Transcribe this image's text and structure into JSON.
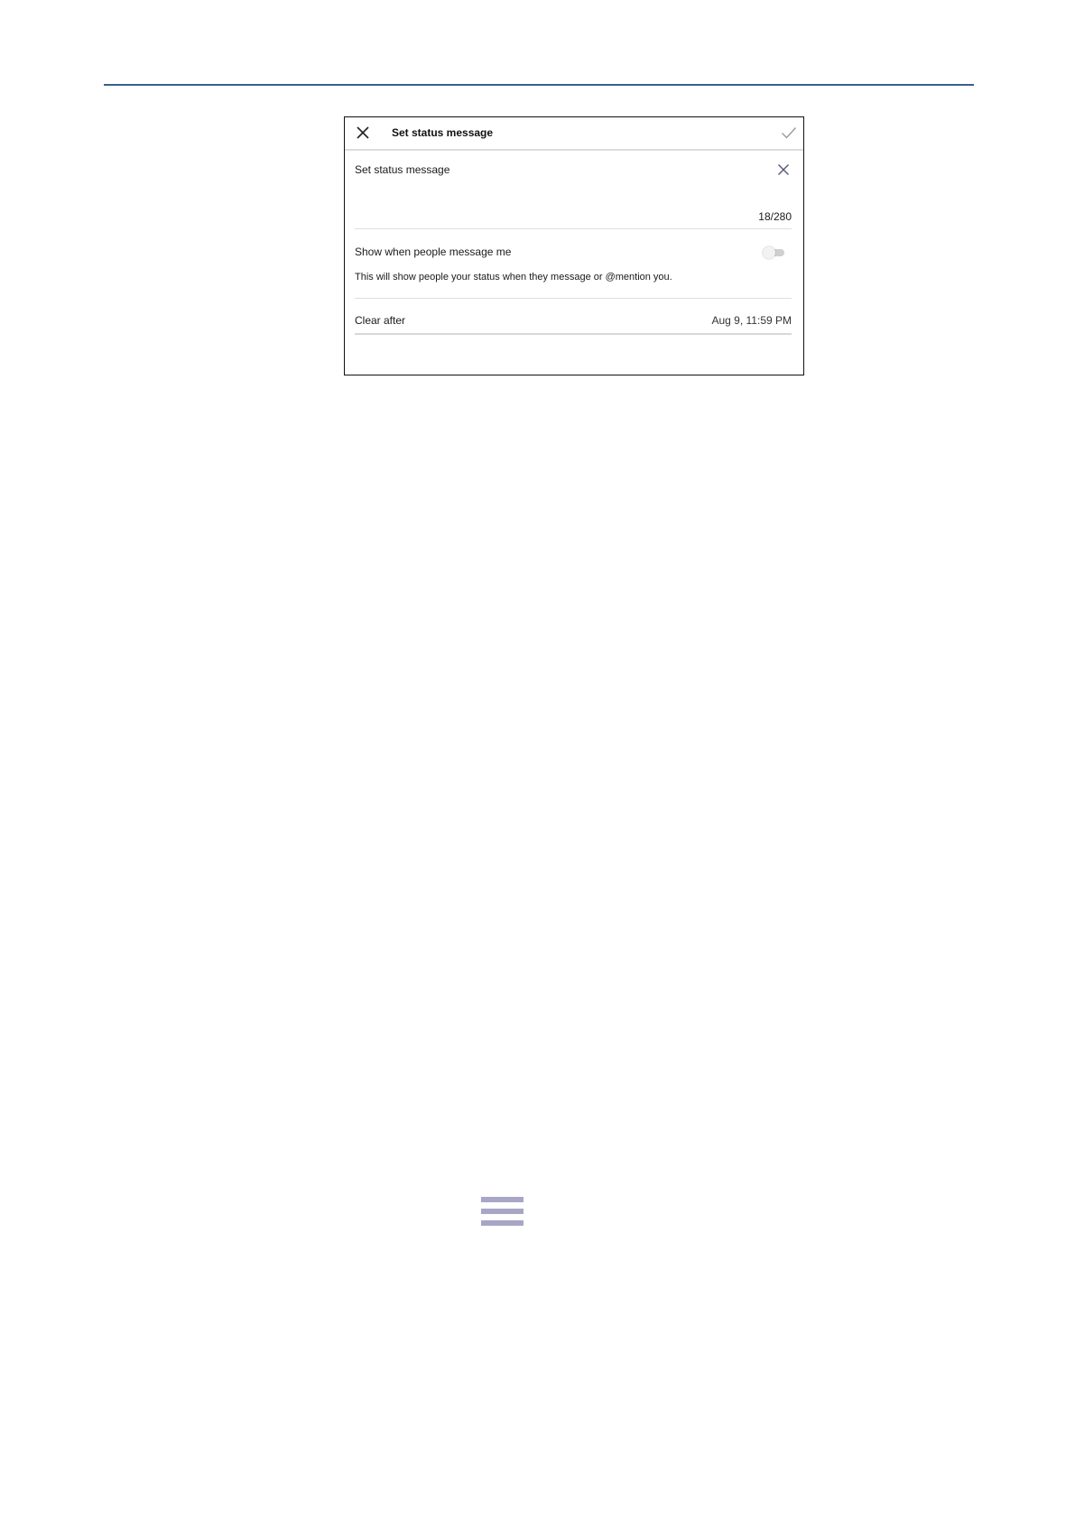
{
  "dialog": {
    "title": "Set status message",
    "field_label": "Set status message",
    "char_count": "18/280",
    "toggle": {
      "label": "Show when people message me",
      "description": "This will show people your status when they message or @mention you.",
      "enabled": false
    },
    "clear_after": {
      "label": "Clear after",
      "value": "Aug 9, 11:59 PM"
    }
  },
  "icons": {
    "header_close": "close-icon",
    "header_confirm": "checkmark-icon",
    "field_clear": "clear-field-icon",
    "menu": "hamburger-menu-icon"
  },
  "colors": {
    "top_rule": "#3a5f8f",
    "menu_icon": "#a8a6c6",
    "toggle_track": "#cfcfcf",
    "divider": "#dedede"
  }
}
